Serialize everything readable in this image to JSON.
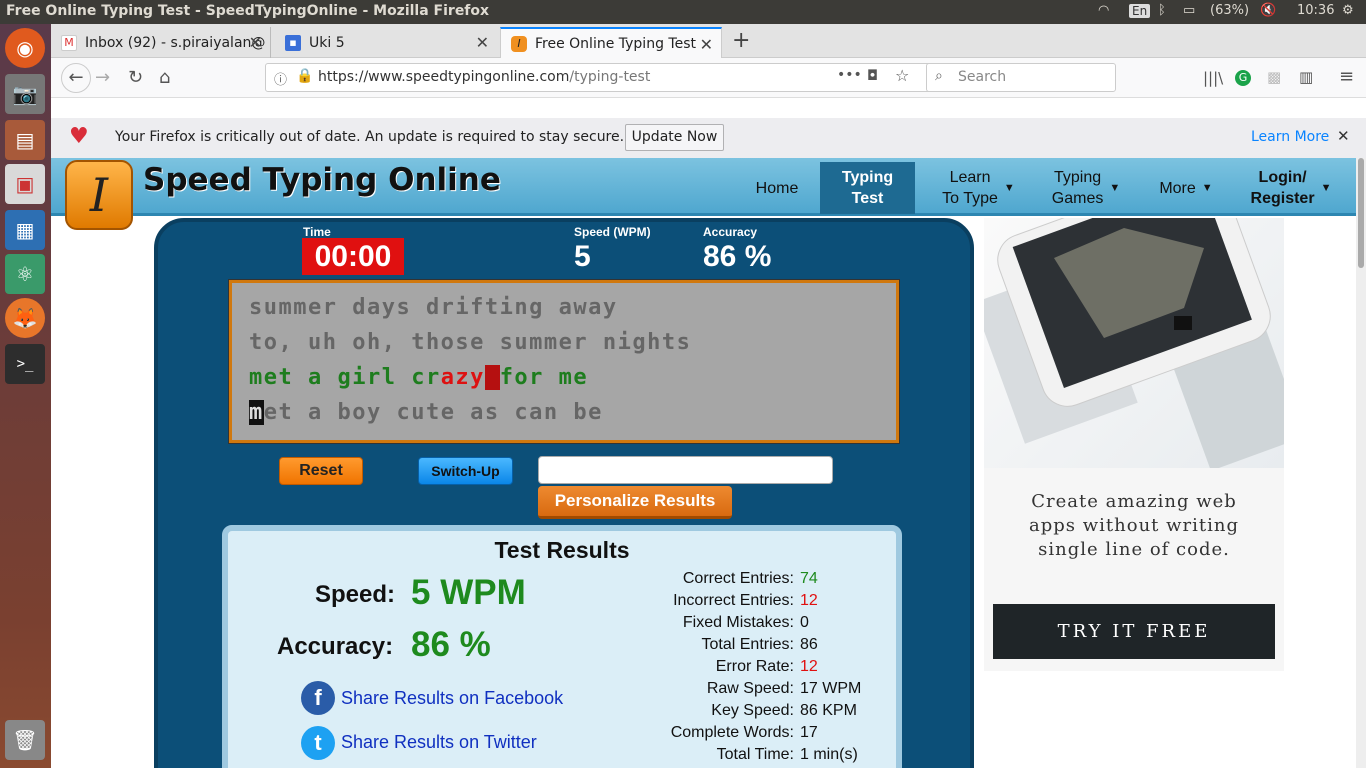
{
  "window": {
    "title": "Free Online Typing Test - SpeedTypingOnline - Mozilla Firefox"
  },
  "system": {
    "keyboard": "En",
    "battery": "(63%)",
    "clock": "10:36"
  },
  "tabs": [
    {
      "label": "Inbox (92) - s.piraiyalan@",
      "icon": "gmail-icon"
    },
    {
      "label": "Uki 5",
      "icon": "classroom-icon"
    },
    {
      "label": "Free Online Typing Test",
      "icon": "speedtyping-icon"
    }
  ],
  "url": {
    "base": "https://www.speedtypingonline.com",
    "path": "/typing-test"
  },
  "search": {
    "placeholder": "Search"
  },
  "notification": {
    "message": "Your Firefox is critically out of date. An update is required to stay secure.",
    "update_button": "Update Now",
    "learn_more": "Learn More"
  },
  "site": {
    "name": "Speed Typing Online",
    "nav": [
      {
        "label": "Home"
      },
      {
        "label1": "Typing",
        "label2": "Test"
      },
      {
        "label1": "Learn",
        "label2": "To Type"
      },
      {
        "label1": "Typing",
        "label2": "Games"
      },
      {
        "label": "More"
      },
      {
        "label1": "Login/",
        "label2": "Register"
      }
    ]
  },
  "test": {
    "time_label": "Time",
    "time": "00:00",
    "speed_label": "Speed (WPM)",
    "speed": "5",
    "accuracy_label": "Accuracy",
    "accuracy": "86 %",
    "lines": [
      "summer days drifting away",
      "to, uh oh, those summer nights",
      "met a girl crazy for me",
      "met a boy cute as can be"
    ],
    "line3_parts": [
      "met a girl cr",
      "azy",
      " ",
      "for",
      " me"
    ],
    "line4_parts": [
      "m",
      "et a boy cute as can be"
    ],
    "reset": "Reset",
    "switch_up": "Switch-Up",
    "personalize": "Personalize Results"
  },
  "results": {
    "title": "Test Results",
    "speed_label": "Speed:",
    "speed_value": "5 WPM",
    "accuracy_label": "Accuracy:",
    "accuracy_value": "86 %",
    "share_facebook": "Share Results on Facebook",
    "share_twitter": "Share Results on Twitter",
    "stats": [
      {
        "label": "Correct Entries:",
        "value": "74",
        "color": "#1e8a1e"
      },
      {
        "label": "Incorrect Entries:",
        "value": "12",
        "color": "#e01010"
      },
      {
        "label": "Fixed Mistakes:",
        "value": "0",
        "color": "#111111"
      },
      {
        "label": "Total Entries:",
        "value": "86",
        "color": "#111111"
      },
      {
        "label": "Error Rate:",
        "value": "12",
        "color": "#e01010"
      },
      {
        "label": "Raw Speed:",
        "value": "17 WPM",
        "color": "#111111"
      },
      {
        "label": "Key Speed:",
        "value": "86 KPM",
        "color": "#111111"
      },
      {
        "label": "Complete Words:",
        "value": "17",
        "color": "#111111"
      },
      {
        "label": "Total Time:",
        "value": "1 min(s)",
        "color": "#111111"
      }
    ]
  },
  "ad": {
    "tagline1": "Create amazing web",
    "tagline2": "apps without writing",
    "tagline3": "single line of code.",
    "cta": "TRY IT FREE"
  }
}
